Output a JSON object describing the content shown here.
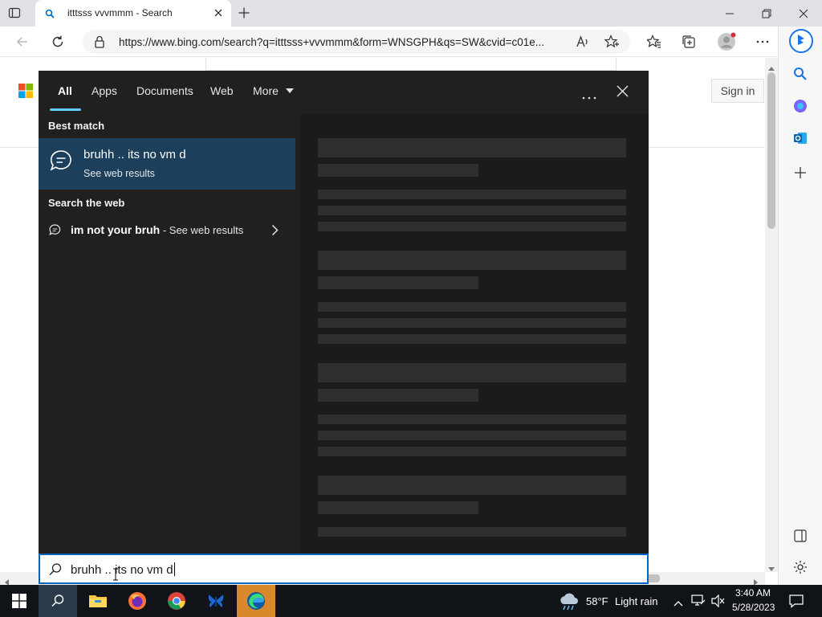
{
  "browser": {
    "tab_title": "itttsss vvvmmm - Search",
    "url": "https://www.bing.com/search?q=itttsss+vvvmmm&form=WNSGPH&qs=SW&cvid=c01e..."
  },
  "bing": {
    "sign_in_label": "Sign in"
  },
  "search_panel": {
    "tabs": [
      "All",
      "Apps",
      "Documents",
      "Web",
      "More"
    ],
    "best_match_heading": "Best match",
    "best_match": {
      "title": "bruhh .. its no vm d",
      "subtitle": "See web results"
    },
    "search_web_heading": "Search the web",
    "web_suggestion": {
      "query": "im not your bruh",
      "suffix": " - See web results"
    }
  },
  "search_box": {
    "value": "bruhh .. its no vm d"
  },
  "taskbar": {
    "weather_temp": "58°F",
    "weather_desc": "Light rain",
    "time": "3:40 AM",
    "date": "5/28/2023"
  },
  "colors": {
    "accent": "#0067c0",
    "selection": "#1c3f5c",
    "panel_bg": "#202020",
    "taskbar_bg": "#101418"
  }
}
